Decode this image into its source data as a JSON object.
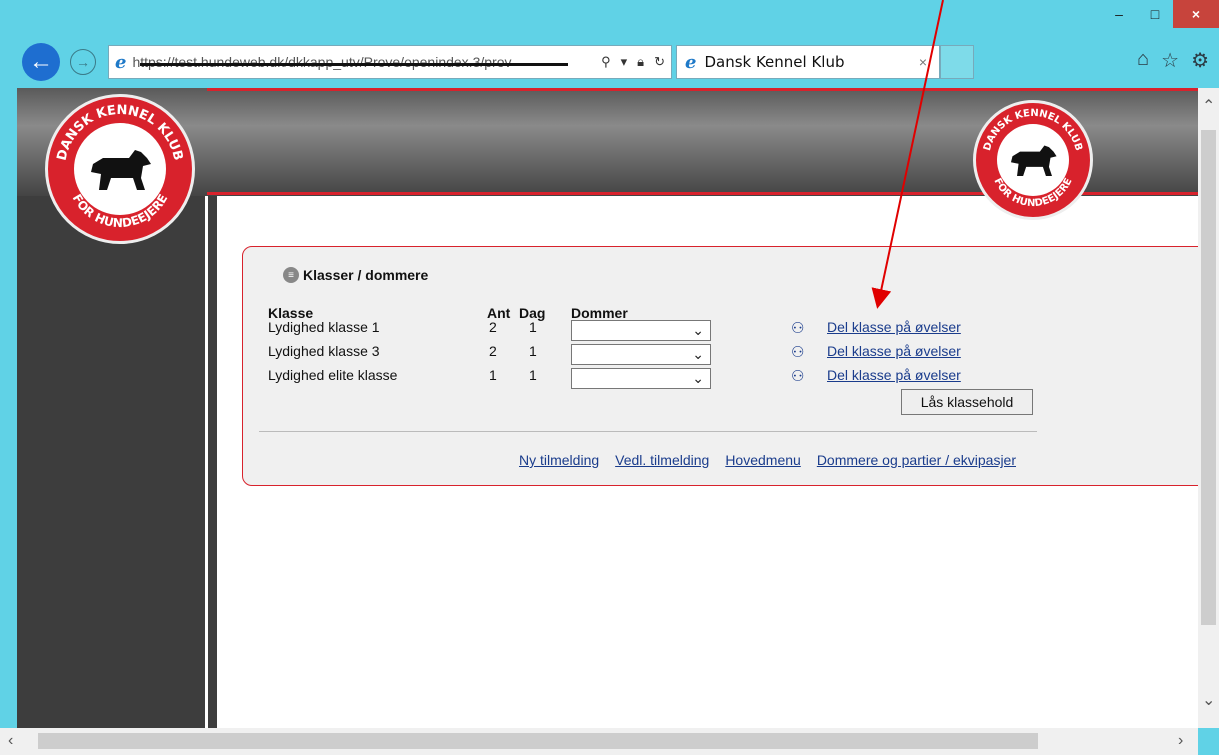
{
  "browser": {
    "url": "https://test.hundeweb.dk/dkkapp_utv/Prove/openindex.3/prov",
    "tab_title": "Dansk Kennel Klub",
    "tab_close": "×",
    "window_controls": {
      "minimize": "–",
      "maximize": "□",
      "close": "×"
    }
  },
  "panel": {
    "title": "Klasser / dommere",
    "headers": {
      "klasse": "Klasse",
      "ant": "Ant",
      "dag": "Dag",
      "dommer": "Dommer"
    },
    "rows": [
      {
        "klasse": "Lydighed klasse 1",
        "ant": "2",
        "dag": "1",
        "dommer": "",
        "link": "Del klasse på øvelser"
      },
      {
        "klasse": "Lydighed klasse 3",
        "ant": "2",
        "dag": "1",
        "dommer": "",
        "link": "Del klasse på øvelser"
      },
      {
        "klasse": "Lydighed elite klasse",
        "ant": "1",
        "dag": "1",
        "dommer": "",
        "link": "Del klasse på øvelser"
      }
    ],
    "lock_button": "Lås klassehold",
    "bottom_links": [
      "Ny tilmelding",
      "Vedl. tilmelding",
      "Hovedmenu",
      "Dommere og partier / ekvipasjer"
    ]
  },
  "logo": {
    "text_top": "DANSK KENNEL KLUB",
    "text_bottom": "FOR HUNDEEJERE"
  },
  "colors": {
    "accent": "#d8222c",
    "link": "#1a3c8c",
    "titlebar": "#60d2e6"
  }
}
